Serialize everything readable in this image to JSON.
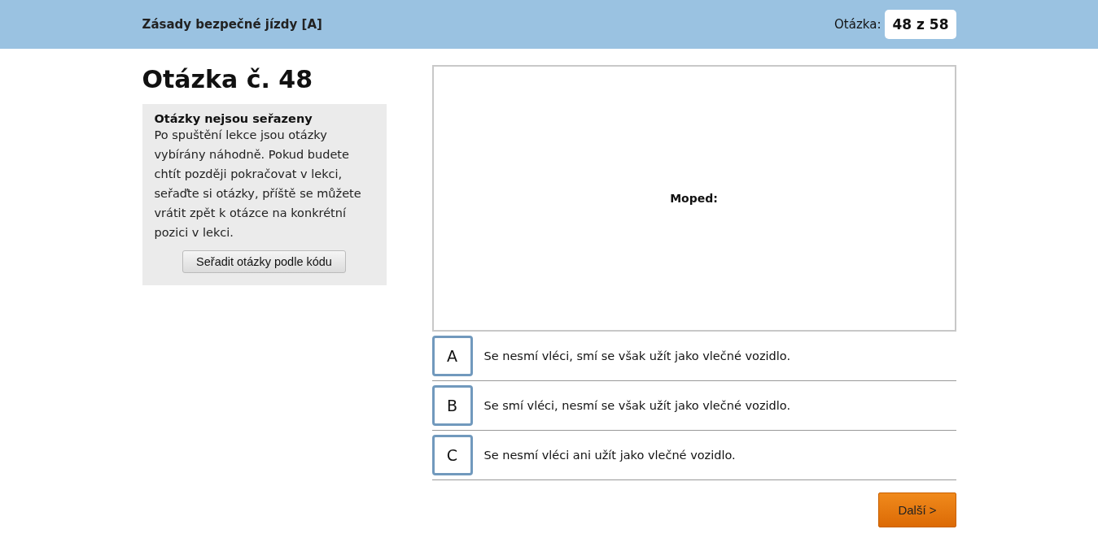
{
  "header": {
    "title": "Zásady bezpečné jízdy [A]",
    "counter_label": "Otázka:",
    "counter": "48 z 58"
  },
  "question_heading": "Otázka č. 48",
  "info_box": {
    "title": "Otázky nejsou seřazeny",
    "text": "Po spuštění lekce jsou otázky vybírány náhodně. Pokud budete chtít později pokračovat v lekci, seřaďte si otázky, příště se můžete vrátit zpět k otázce na konkrétní pozici v lekci.",
    "button": "Seřadit otázky podle kódu"
  },
  "question": {
    "text": "Moped:"
  },
  "answers": [
    {
      "letter": "A",
      "text": "Se nesmí vléci, smí se však užít jako vlečné vozidlo.",
      "selected": false
    },
    {
      "letter": "B",
      "text": "Se smí vléci, nesmí se však užít jako vlečné vozidlo.",
      "selected": false
    },
    {
      "letter": "C",
      "text": "Se nesmí vléci ani užít jako vlečné vozidlo.",
      "selected": false
    }
  ],
  "next_button": "Další >"
}
